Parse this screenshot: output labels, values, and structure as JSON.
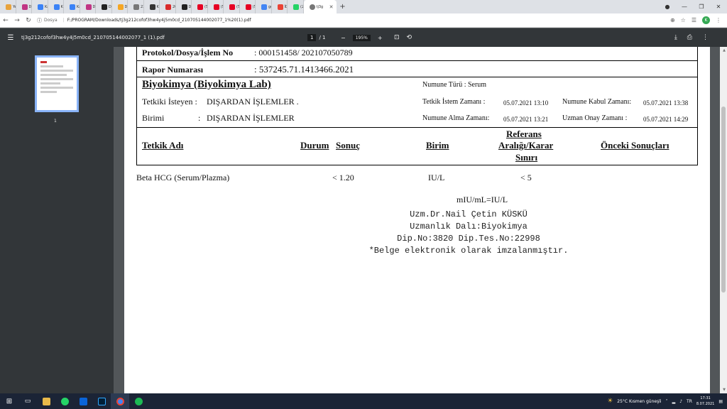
{
  "tabs": [
    {
      "label": "Yen",
      "color": "#e8a33d"
    },
    {
      "label": "Der",
      "color": "#c13584"
    },
    {
      "label": "Kar",
      "color": "#3b82f6"
    },
    {
      "label": "Kar",
      "color": "#3b82f6"
    },
    {
      "label": "Kar",
      "color": "#3b82f6"
    },
    {
      "label": "Der",
      "color": "#c13584"
    },
    {
      "label": "D-I",
      "color": "#222222"
    },
    {
      "label": "D-I",
      "color": "#f5a623"
    },
    {
      "label": "23",
      "color": "#777777"
    },
    {
      "label": "Kar",
      "color": "#333333"
    },
    {
      "label": "20l",
      "color": "#d92b2b"
    },
    {
      "label": "D-I",
      "color": "#222222"
    },
    {
      "label": "(5) Pin",
      "color": "#e60023"
    },
    {
      "label": "(5) Pin",
      "color": "#e60023"
    },
    {
      "label": "(5) Pin",
      "color": "#e60023"
    },
    {
      "label": "(5) Pin",
      "color": "#e60023"
    },
    {
      "label": "gevin",
      "color": "#4285f4"
    },
    {
      "label": "İDARG",
      "color": "#ea4335"
    },
    {
      "label": "(2) Wh",
      "color": "#25d366"
    }
  ],
  "active_tab": {
    "label": "tj3g",
    "color": "#777777"
  },
  "address": {
    "scheme": "Dosya",
    "url": "F:/PROGRAM/Downloads/tj3g212cofof3hw4y4j5m0cd_210705144002077_1%20(1).pdf",
    "profile": "K"
  },
  "pdf": {
    "filename": "tj3g212cofof3hw4y4j5m0cd_210705144002077_1 (1).pdf",
    "page": "1",
    "total": "/  1",
    "zoom": "195%",
    "thumb_number": "1"
  },
  "report": {
    "protokol_label": "Protokol/Dosya/İşlem No",
    "protokol_value": ": 000151458/ 202107050789",
    "rapor_label": "Rapor Numarası",
    "rapor_value": ": 537245.71.1413466.2021",
    "section_title": "Biyokimya  (Biyokimya Lab)",
    "numune_turu": "Numune Türü :  Serum",
    "tetkiki_isteyen_label": "Tetkiki İsteyen :",
    "tetkiki_isteyen_value": "DIŞARDAN İŞLEMLER .",
    "birimi_label": "Birimi",
    "birimi_colon": ":",
    "birimi_value": "DIŞARDAN İŞLEMLER",
    "tetkik_istem_label": "Tetkik İstem Zamanı  :",
    "tetkik_istem_value": "05.07.2021 13:10",
    "numune_kabul_label": "Numune Kabul Zamanı:",
    "numune_kabul_value": "05.07.2021 13:38",
    "numune_alma_label": "Numune Alma Zamanı:",
    "numune_alma_value": "05.07.2021 13:21",
    "uzman_onay_label": "Uzman Onay Zamanı  :",
    "uzman_onay_value": "05.07.2021 14:29",
    "headers": {
      "tetkik": "Tetkik Adı",
      "durum": "Durum",
      "sonuc": "Sonuç",
      "birim": "Birim",
      "ref1": "Referans",
      "ref2": "Aralığı/Karar",
      "ref3": "Sınırı",
      "onceki": "Önceki Sonuçları"
    },
    "row": {
      "name": "Beta HCG (Serum/Plazma)",
      "result": "< 1.20",
      "unit": "IU/L",
      "ref": "< 5"
    },
    "note": "mIU/mL=IU/L",
    "sig1": "Uzm.Dr.Nail Çetin KÜSKÜ",
    "sig2": "Uzmanlık Dalı:Biyokimya",
    "sig3": "Dip.No:3820 Dip.Tes.No:22998",
    "sig4": "*Belge elektronik olarak imzalanmıştır."
  },
  "taskbar": {
    "weather": "25°C  Kısmen güneşli",
    "time": "17:31",
    "date": "8.07.2021"
  }
}
